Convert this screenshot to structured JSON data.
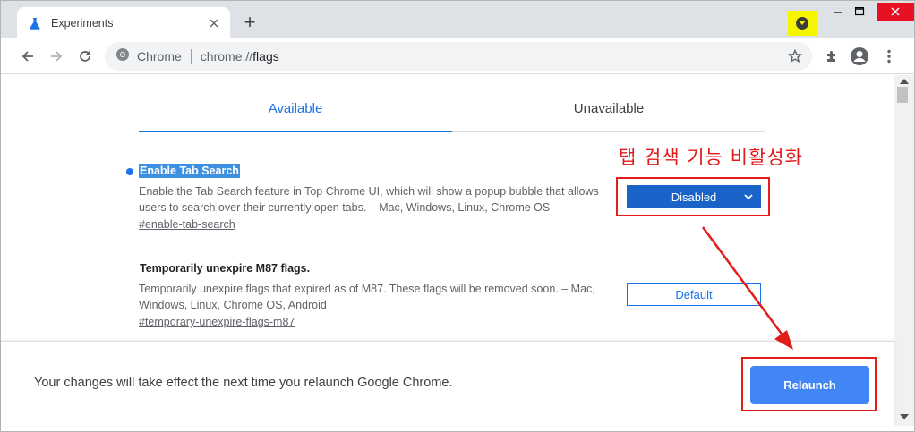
{
  "tab": {
    "title": "Experiments",
    "icon": "flask-icon"
  },
  "new_tab_label": "+",
  "toolbar": {
    "site_label": "Chrome",
    "url_scheme": "chrome://",
    "url_path": "flags"
  },
  "content_tabs": [
    {
      "label": "Available",
      "active": true
    },
    {
      "label": "Unavailable",
      "active": false
    }
  ],
  "flags": [
    {
      "title": "Enable Tab Search",
      "description": "Enable the Tab Search feature in Top Chrome UI, which will show a popup bubble that allows users to search over their currently open tabs. – Mac, Windows, Linux, Chrome OS",
      "link": "#enable-tab-search",
      "value": "Disabled"
    },
    {
      "title": "Temporarily unexpire M87 flags.",
      "description": "Temporarily unexpire flags that expired as of M87. These flags will be removed soon. – Mac, Windows, Linux, Chrome OS, Android",
      "link": "#temporary-unexpire-flags-m87",
      "value": "Default"
    }
  ],
  "annotation": {
    "text": "탭 검색  기능 비활성화",
    "color": "#e21b1b"
  },
  "footer": {
    "message": "Your changes will take effect the next time you relaunch Google Chrome.",
    "relaunch_label": "Relaunch"
  },
  "colors": {
    "accent": "#1a73e8",
    "relaunch": "#4285f4",
    "annotation": "#e21b1b",
    "highlight_chip": "#f5f500"
  }
}
